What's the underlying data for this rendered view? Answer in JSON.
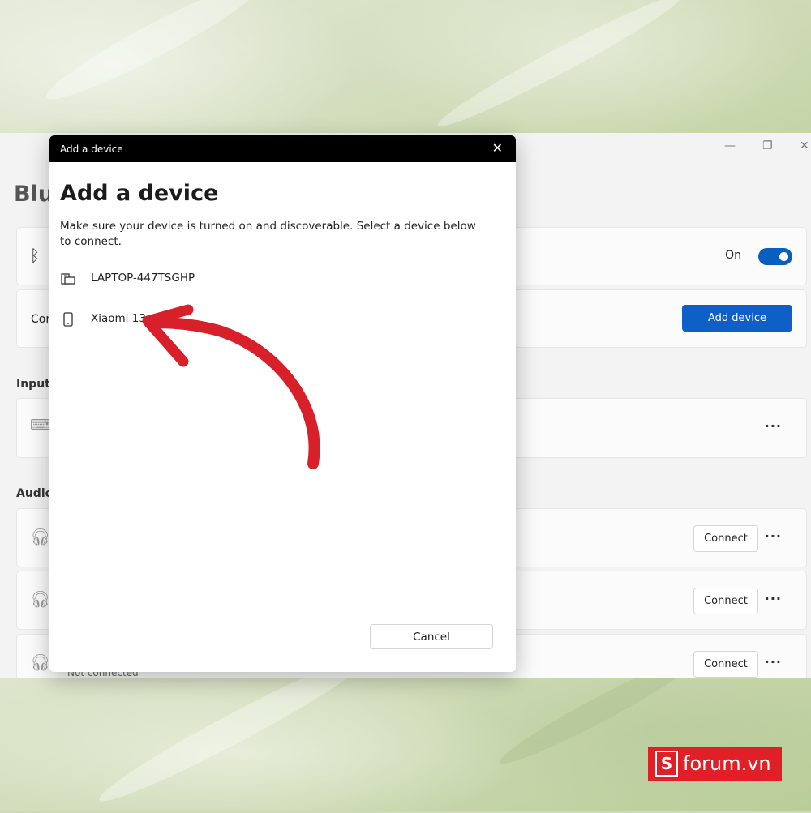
{
  "settings": {
    "title": "Blu",
    "window_controls": [
      "—",
      "❐",
      "✕"
    ],
    "bluetooth_toggle_label": "On",
    "add_row_label": "Con",
    "add_device_button": "Add device",
    "sections": {
      "input": "Input",
      "audio": "Audio"
    },
    "audio_connect_labels": [
      "Connect",
      "Connect",
      "Connect"
    ],
    "more_label": "···",
    "status_text": "Not connected"
  },
  "dialog": {
    "titlebar": "Add a device",
    "heading": "Add a device",
    "description": "Make sure your device is turned on and discoverable. Select a device below to connect.",
    "devices": [
      {
        "label": "LAPTOP-447TSGHP",
        "icon": "laptop-icon"
      },
      {
        "label": "Xiaomi 13",
        "icon": "phone-icon"
      }
    ],
    "cancel_button": "Cancel"
  },
  "annotation": {
    "color": "#d8202a"
  },
  "watermark": {
    "letter": "S",
    "text": "forum.vn",
    "color": "#e01f26"
  },
  "colors": {
    "accent": "#0f5fc8",
    "toggle_on": "#0a5ebf"
  }
}
